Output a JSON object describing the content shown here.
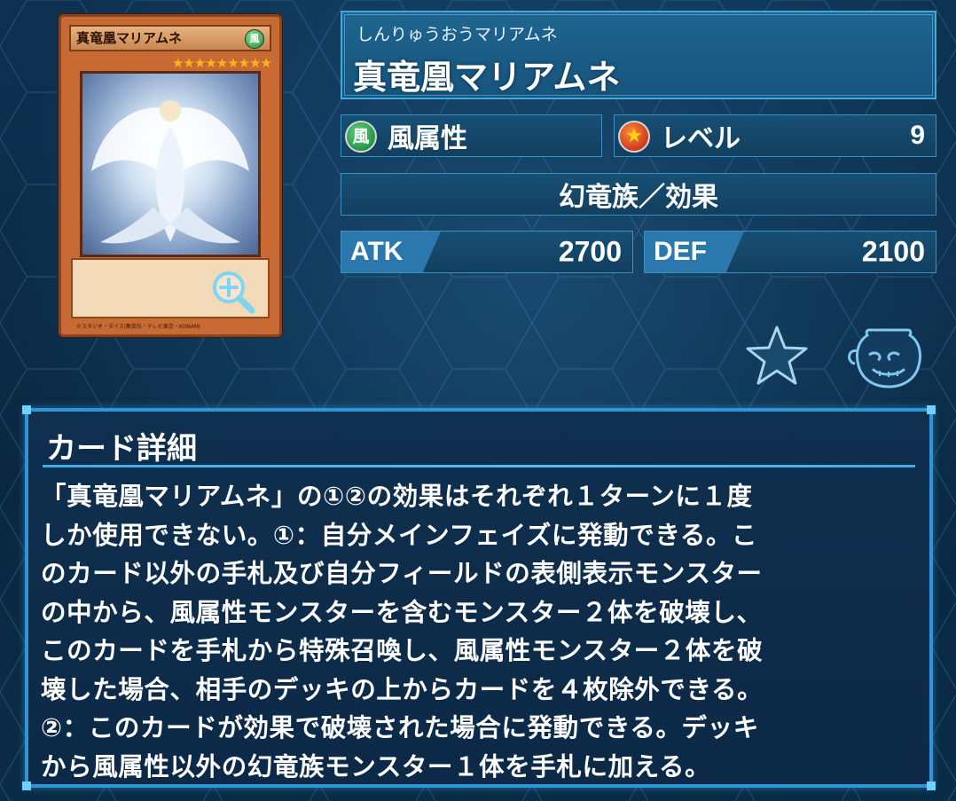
{
  "card": {
    "image_name": "真竜凰マリアムネ",
    "attribute_glyph": "風",
    "stars": "★★★★★★★★★",
    "footer": "©スタジオ・ダイス/集英社・テレビ東京・KONAMI"
  },
  "header": {
    "ruby": "しんりゅうおうマリアムネ",
    "name": "真竜凰マリアムネ"
  },
  "attribute": {
    "icon": "wind-attribute-icon",
    "glyph": "風",
    "label": "風属性"
  },
  "level": {
    "icon": "level-star-icon",
    "label": "レベル",
    "value": "9"
  },
  "type_line": "幻竜族／効果",
  "stats": {
    "atk_label": "ATK",
    "atk": "2700",
    "def_label": "DEF",
    "def": "2100"
  },
  "icons": {
    "favorite": "star-icon",
    "collection": "pot-icon",
    "zoom": "zoom-in-icon"
  },
  "detail": {
    "title": "カード詳細",
    "lines": [
      "「真竜凰マリアムネ」の①②の効果はそれぞれ１ターンに１度",
      "しか使用できない。①：自分メインフェイズに発動できる。こ",
      "のカード以外の手札及び自分フィールドの表側表示モンスター",
      "の中から、風属性モンスターを含むモンスター２体を破壊し、",
      "このカードを手札から特殊召喚し、風属性モンスター２体を破",
      "壊した場合、相手のデッキの上からカードを４枚除外できる。",
      "②：このカードが効果で破壊された場合に発動できる。デッキ",
      "から風属性以外の幻竜族モンスター１体を手札に加える。"
    ]
  },
  "colors": {
    "background": "#0b2a45",
    "panel": "#175075",
    "accent": "#2f95d6",
    "card_frame": "#c76a34"
  }
}
